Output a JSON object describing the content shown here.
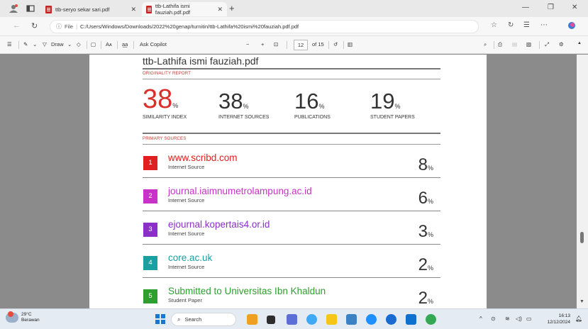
{
  "tabs": [
    {
      "title": "ttb-seryo sekar sari.pdf",
      "active": false
    },
    {
      "title": "ttb-Lathifa ismi fauziah.pdf.pdf",
      "active": true
    }
  ],
  "address": {
    "scheme_label": "File",
    "url": "C:/Users/Windows/Downloads/2022%20genap/turnitin/ttb-Lathifa%20ismi%20fauziah.pdf.pdf"
  },
  "pdf_toolbar": {
    "draw_label": "Draw",
    "read_aloud_label": "Aᴀ",
    "copilot_label": "Ask Copilot",
    "zoom_out": "−",
    "zoom_in": "+",
    "page_current": "12",
    "page_total": "of 15"
  },
  "document": {
    "title": "ttb-Lathifa ismi fauziah.pdf",
    "originality_label": "ORIGINALITY REPORT",
    "primary_sources_label": "PRIMARY SOURCES",
    "stats": [
      {
        "value": "38",
        "pct": "%",
        "label": "SIMILARITY INDEX",
        "highlight": true
      },
      {
        "value": "38",
        "pct": "%",
        "label": "INTERNET SOURCES",
        "highlight": false
      },
      {
        "value": "16",
        "pct": "%",
        "label": "PUBLICATIONS",
        "highlight": false
      },
      {
        "value": "19",
        "pct": "%",
        "label": "STUDENT PAPERS",
        "highlight": false
      }
    ],
    "sources": [
      {
        "rank": "1",
        "name": "www.scribd.com",
        "type": "Internet Source",
        "value": "8",
        "pct": "%",
        "color": "#e02020"
      },
      {
        "rank": "2",
        "name": "journal.iaimnumetrolampung.ac.id",
        "type": "Internet Source",
        "value": "6",
        "pct": "%",
        "color": "#c832c8"
      },
      {
        "rank": "3",
        "name": "ejournal.kopertais4.or.id",
        "type": "Internet Source",
        "value": "3",
        "pct": "%",
        "color": "#8b2fc9"
      },
      {
        "rank": "4",
        "name": "core.ac.uk",
        "type": "Internet Source",
        "value": "2",
        "pct": "%",
        "color": "#1aa0a0"
      },
      {
        "rank": "5",
        "name": "Submitted to Universitas Ibn Khaldun",
        "type": "Student Paper",
        "value": "2",
        "pct": "%",
        "color": "#2e9e2e"
      }
    ]
  },
  "taskbar": {
    "weather_temp": "29°C",
    "weather_desc": "Berawan",
    "search_label": "Search",
    "time": "16:13",
    "date": "12/12/2024"
  },
  "colors": {
    "similarity_red": "#d9302b",
    "section_label_red": "#c0392b"
  }
}
